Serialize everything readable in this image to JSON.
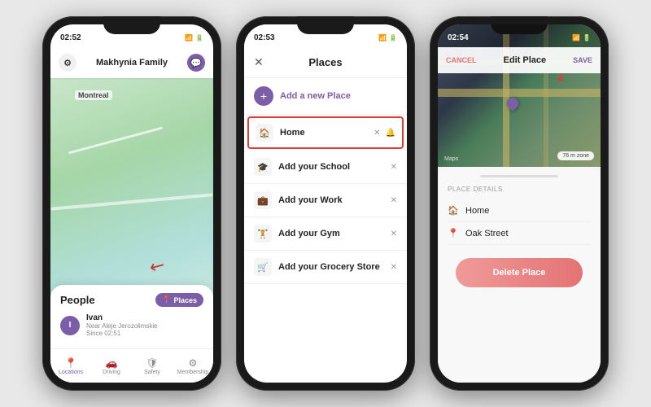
{
  "phone1": {
    "statusbar": {
      "time": "02:52",
      "icons": "▲ ◻ 📶 🔋"
    },
    "topbar": {
      "family_label": "Makhynia Family",
      "gear_icon": "⚙",
      "chat_icon": "💬"
    },
    "map": {
      "label": "Montreal"
    },
    "bottom_panel": {
      "people_label": "People",
      "places_btn": "📍 Places",
      "user_name": "Ivan",
      "user_loc": "Near Aleje Jerozolimskie",
      "user_since": "Since 02:51"
    },
    "nav": {
      "items": [
        {
          "label": "Locations",
          "icon": "📍"
        },
        {
          "label": "Driving",
          "icon": "🚗"
        },
        {
          "label": "Safety",
          "icon": "🛡"
        },
        {
          "label": "Membership",
          "icon": "⚙"
        }
      ]
    }
  },
  "phone2": {
    "statusbar": {
      "time": "02:53",
      "icons": "▲ ◻ 📶 🔋"
    },
    "header": {
      "title": "Places",
      "close_icon": "✕"
    },
    "add_place": {
      "label": "Add a new Place",
      "icon": "+"
    },
    "places": [
      {
        "name": "Home",
        "icon": "🏠",
        "highlighted": true,
        "has_lock": true
      },
      {
        "name": "Add your School",
        "icon": "🎓",
        "highlighted": false,
        "has_lock": false
      },
      {
        "name": "Add your Work",
        "icon": "💼",
        "highlighted": false,
        "has_lock": false
      },
      {
        "name": "Add your Gym",
        "icon": "🏋",
        "highlighted": false,
        "has_lock": false
      },
      {
        "name": "Add your Grocery Store",
        "icon": "🛒",
        "highlighted": false,
        "has_lock": false
      }
    ]
  },
  "phone3": {
    "statusbar": {
      "time": "02:54",
      "icons": "▲ ◻ 📶 🔋"
    },
    "topbar": {
      "cancel": "CANCEL",
      "title": "Edit Place",
      "save": "SAVE"
    },
    "map": {
      "maps_label": "Maps",
      "distance": "76 m zone"
    },
    "place_details": {
      "label": "Place details",
      "place_name": "Home",
      "address": "Oak Street"
    },
    "delete_btn": "Delete Place"
  }
}
